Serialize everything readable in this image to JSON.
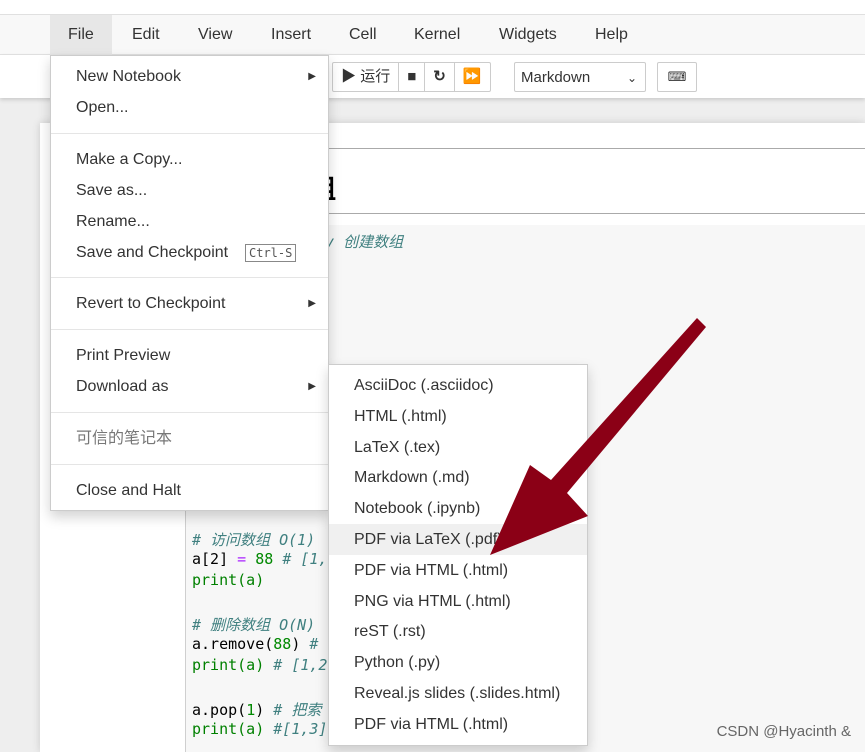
{
  "menubar": [
    "File",
    "Edit",
    "View",
    "Insert",
    "Cell",
    "Kernel",
    "Widgets",
    "Help"
  ],
  "toolbar": {
    "run_label": "运行",
    "cell_type": "Markdown"
  },
  "notebook": {
    "heading_fragment": "组",
    "first_line": "ay 创建数组",
    "code_lines": [
      {
        "type": "comment",
        "text": "# 访问数组 O(1)"
      },
      {
        "type": "assign",
        "a": "a[2]",
        "op": "=",
        "num": "88",
        "comment": "# [1,"
      },
      {
        "type": "print",
        "text": "print(a)"
      },
      {
        "type": "blank",
        "text": ""
      },
      {
        "type": "comment",
        "text": "# 删除数组 O(N)"
      },
      {
        "type": "call",
        "code": "a.remove(",
        "num": "88",
        ")": ")",
        "comment": "# "
      },
      {
        "type": "printc",
        "text": "print(a)",
        "comment": "# [1,2"
      },
      {
        "type": "blank",
        "text": ""
      },
      {
        "type": "call",
        "code": "a.pop(",
        "num": "1",
        ")": ")",
        "comment": "# 把索"
      },
      {
        "type": "printc",
        "text": "print(a)",
        "comment": "#[1,3]"
      }
    ]
  },
  "file_menu": {
    "groups": [
      [
        {
          "label": "New Notebook",
          "submenu": true
        },
        {
          "label": "Open..."
        }
      ],
      [
        {
          "label": "Make a Copy..."
        },
        {
          "label": "Save as..."
        },
        {
          "label": "Rename..."
        },
        {
          "label": "Save and Checkpoint",
          "shortcut": "Ctrl-S"
        }
      ],
      [
        {
          "label": "Revert to Checkpoint",
          "submenu": true
        }
      ],
      [
        {
          "label": "Print Preview"
        },
        {
          "label": "Download as",
          "submenu": true
        }
      ],
      [
        {
          "label": "可信的笔记本",
          "disabled": true
        }
      ],
      [
        {
          "label": "Close and Halt"
        }
      ]
    ]
  },
  "download_submenu": [
    "AsciiDoc (.asciidoc)",
    "HTML (.html)",
    "LaTeX (.tex)",
    "Markdown (.md)",
    "Notebook (.ipynb)",
    "PDF via LaTeX (.pdf)",
    "PDF via HTML (.html)",
    "PNG via HTML (.html)",
    "reST (.rst)",
    "Python (.py)",
    "Reveal.js slides (.slides.html)",
    "PDF via HTML (.html)"
  ],
  "highlighted_item": "PDF via LaTeX (.pdf)",
  "annotation_arrow_color": "#8b0016",
  "watermark": "CSDN @Hyacinth &"
}
